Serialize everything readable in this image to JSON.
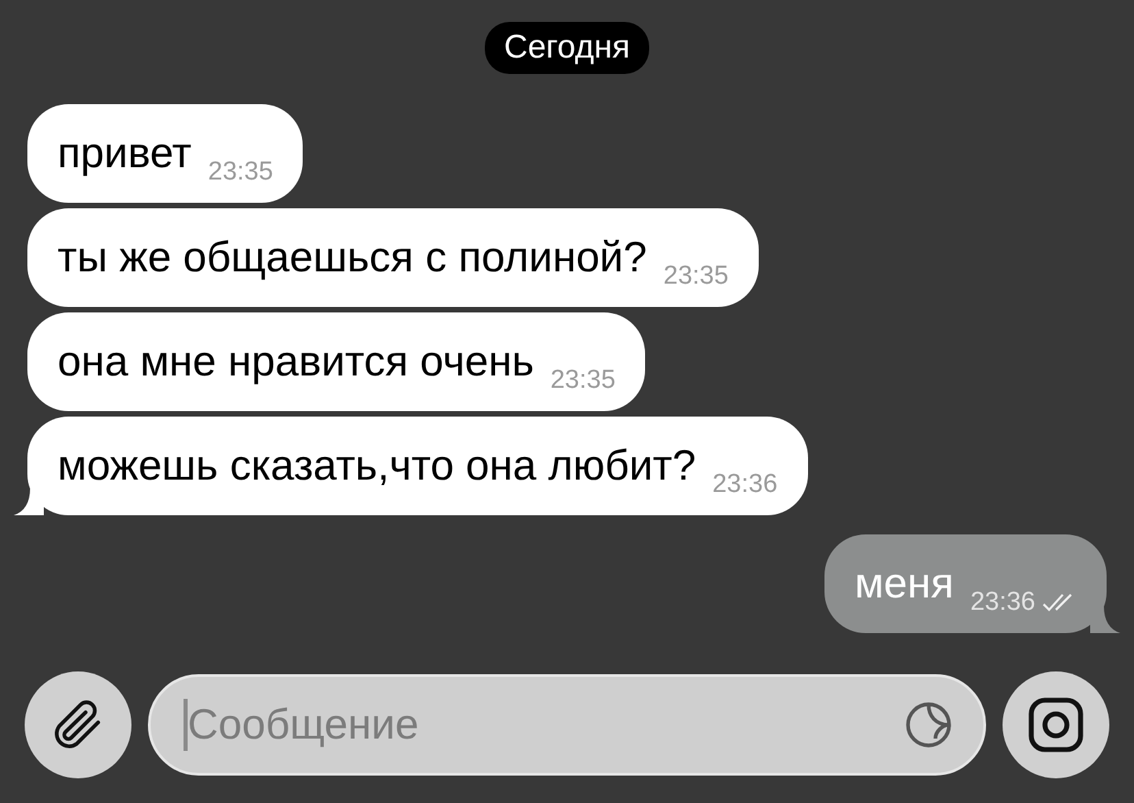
{
  "date_badge": "Сегодня",
  "messages": [
    {
      "kind": "incoming",
      "text": "привет",
      "time": "23:35"
    },
    {
      "kind": "incoming",
      "text": "ты же общаешься с полиной?",
      "time": "23:35"
    },
    {
      "kind": "incoming",
      "text": "она мне нравится очень",
      "time": "23:35"
    },
    {
      "kind": "incoming",
      "text": "можешь сказать,что она любит?",
      "time": "23:36"
    },
    {
      "kind": "outgoing",
      "text": "меня",
      "time": "23:36",
      "read": true
    }
  ],
  "composer": {
    "placeholder": "Сообщение"
  }
}
